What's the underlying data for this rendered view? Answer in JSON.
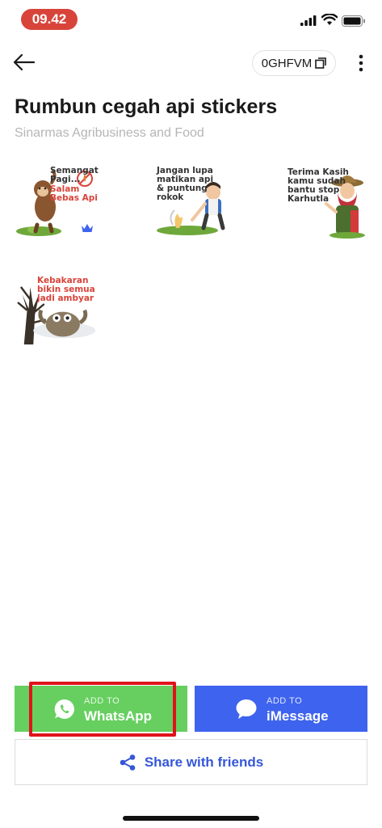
{
  "status_bar": {
    "time": "09.42"
  },
  "header": {
    "pack_code": "0GHFVM"
  },
  "pack": {
    "title": "Rumbun cegah api stickers",
    "author": "Sinarmas Agribusiness and Food"
  },
  "stickers": [
    {
      "line1": "Semangat",
      "line2": "Pagi...",
      "line3": "Salam",
      "line4": "Bebas Api"
    },
    {
      "line1": "Jangan lupa",
      "line2": "matikan api",
      "line3": "& puntung",
      "line4": "rokok"
    },
    {
      "line1": "Terima Kasih",
      "line2": "kamu sudah",
      "line3": "bantu stop",
      "line4": "Karhutla"
    },
    {
      "line1": "Kebakaran",
      "line2": "bikin semua",
      "line3": "jadi ambyar"
    }
  ],
  "actions": {
    "whatsapp": {
      "sub": "ADD TO",
      "label": "WhatsApp",
      "color": "#66cf5f"
    },
    "imessage": {
      "sub": "ADD TO",
      "label": "iMessage",
      "color": "#3e63ee"
    },
    "share": {
      "label": "Share with friends"
    }
  },
  "colors": {
    "highlight": "#e0131b",
    "time_pill": "#d9443a",
    "accent_blue": "#3557d8"
  }
}
